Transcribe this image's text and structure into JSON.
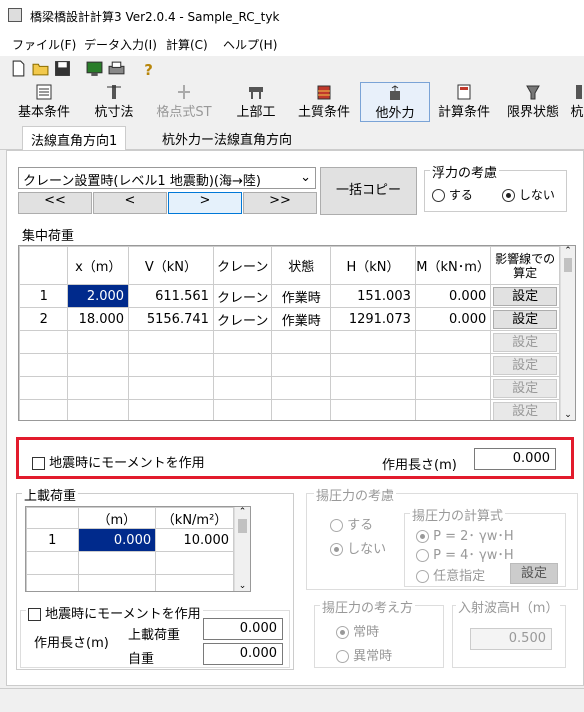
{
  "window": {
    "title": "橋梁橋設計計算3 Ver2.0.4 - Sample_RC_tyk"
  },
  "menu": [
    "ファイル(F)",
    "データ入力(I)",
    "計算(C)",
    "ヘルプ(H)"
  ],
  "toolbar": [
    {
      "label": "基本条件",
      "icon": "basic-conditions-icon"
    },
    {
      "label": "杭寸法",
      "icon": "pile-dimension-icon"
    },
    {
      "label": "格点式ST",
      "icon": "node-st-icon",
      "disabled": true
    },
    {
      "label": "上部工",
      "icon": "superstructure-icon"
    },
    {
      "label": "土質条件",
      "icon": "soil-conditions-icon"
    },
    {
      "label": "他外力",
      "icon": "other-forces-icon",
      "active": true
    },
    {
      "label": "計算条件",
      "icon": "calc-conditions-icon"
    },
    {
      "label": "限界状態",
      "icon": "limit-state-icon"
    },
    {
      "label": "杭",
      "icon": "pile-icon"
    }
  ],
  "tabs": [
    "法線直角方向1",
    "杭外力ー法線直角方向"
  ],
  "case_select": "クレーン設置時(レベル1 地震動)(海→陸)",
  "nav": [
    "<<",
    "<",
    ">",
    ">>"
  ],
  "copy_button": "一括コピー",
  "buoyancy": {
    "title": "浮力の考慮",
    "opt_yes": "する",
    "opt_no": "しない",
    "selected": "no"
  },
  "concentrated": {
    "title": "集中荷重",
    "headers": [
      "",
      "x（m）",
      "V（kN）",
      "クレーン",
      "状態",
      "H（kN）",
      "M（kN･m）",
      "影響線での算定"
    ],
    "rows": [
      [
        "1",
        "2.000",
        "611.561",
        "クレーン",
        "作業時",
        "151.003",
        "0.000"
      ],
      [
        "2",
        "18.000",
        "5156.741",
        "クレーン",
        "作業時",
        "1291.073",
        "0.000"
      ]
    ],
    "set_label": "設定",
    "empty_rows": 5
  },
  "moment_quake": {
    "label": "地震時にモーメントを作用",
    "length_label": "作用長さ(m)",
    "length_value": "0.000"
  },
  "surcharge": {
    "title": "上載荷重",
    "headers": [
      "",
      "（m）",
      "（kN/m²）"
    ],
    "rows": [
      [
        "1",
        "0.000",
        "10.000"
      ]
    ],
    "moment_label": "地震時にモーメントを作用",
    "length_label": "作用長さ(m)",
    "load_label": "上載荷重",
    "load_value": "0.000",
    "self_label": "自重",
    "self_value": "0.000"
  },
  "uplift": {
    "title": "揚圧力の考慮",
    "opt_yes": "する",
    "opt_no": "しない",
    "formula_title": "揚圧力の計算式",
    "formulas": [
      "P = 2･ γw･H",
      "P = 4･ γw･H",
      "任意指定"
    ],
    "set_label": "設定",
    "method_title": "揚圧力の考え方",
    "methods": [
      "常時",
      "異常時"
    ],
    "wave_title": "入射波高H（m）",
    "wave_value": "0.500"
  }
}
